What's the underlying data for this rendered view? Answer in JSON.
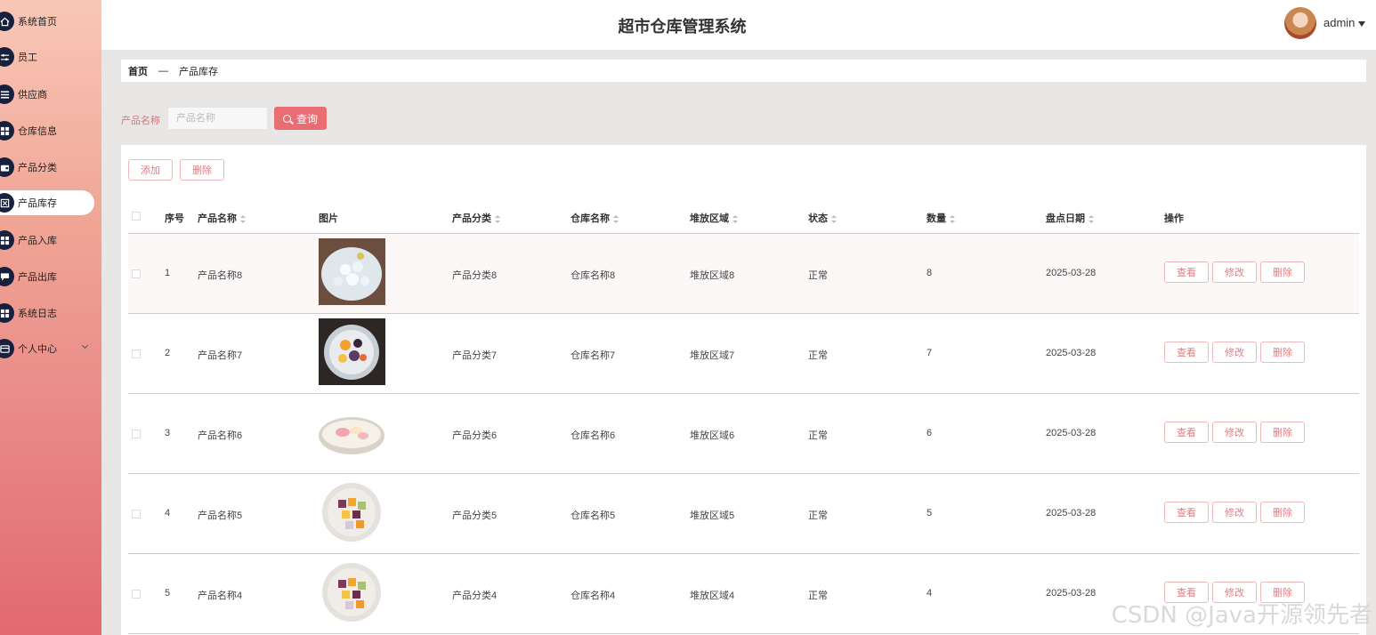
{
  "sidebar": {
    "items": [
      {
        "label": "系统首页",
        "icon": "home-icon"
      },
      {
        "label": "员工",
        "icon": "sliders-icon"
      },
      {
        "label": "供应商",
        "icon": "list-icon"
      },
      {
        "label": "仓库信息",
        "icon": "grid-icon"
      },
      {
        "label": "产品分类",
        "icon": "wallet-icon"
      },
      {
        "label": "产品库存",
        "icon": "box-icon",
        "active": true
      },
      {
        "label": "产品入库",
        "icon": "grid-icon"
      },
      {
        "label": "产品出库",
        "icon": "chat-icon"
      },
      {
        "label": "系统日志",
        "icon": "grid-icon"
      },
      {
        "label": "个人中心",
        "icon": "card-icon",
        "has_submenu": true
      }
    ]
  },
  "header": {
    "title": "超市仓库管理系统",
    "username": "admin"
  },
  "breadcrumb": {
    "home": "首页",
    "separator": "—",
    "current": "产品库存"
  },
  "search": {
    "label": "产品名称",
    "placeholder": "产品名称",
    "value": "",
    "button": "查询"
  },
  "toolbar": {
    "add": "添加",
    "delete": "删除"
  },
  "table": {
    "columns": [
      "序号",
      "产品名称",
      "图片",
      "产品分类",
      "仓库名称",
      "堆放区域",
      "状态",
      "数量",
      "盘点日期",
      "操作"
    ],
    "row_actions": {
      "view": "查看",
      "edit": "修改",
      "delete": "删除"
    },
    "rows": [
      {
        "index": "1",
        "name": "产品名称8",
        "image": "shaved-ice-photo",
        "category": "产品分类8",
        "warehouse": "仓库名称8",
        "area": "堆放区域8",
        "status": "正常",
        "quantity": "8",
        "date": "2025-03-28"
      },
      {
        "index": "2",
        "name": "产品名称7",
        "image": "dessert-bowl-photo",
        "category": "产品分类7",
        "warehouse": "仓库名称7",
        "area": "堆放区域7",
        "status": "正常",
        "quantity": "7",
        "date": "2025-03-28"
      },
      {
        "index": "3",
        "name": "产品名称6",
        "image": "rolls-plate-photo",
        "category": "产品分类6",
        "warehouse": "仓库名称6",
        "area": "堆放区域6",
        "status": "正常",
        "quantity": "6",
        "date": "2025-03-28"
      },
      {
        "index": "4",
        "name": "产品名称5",
        "image": "taro-balls-photo",
        "category": "产品分类5",
        "warehouse": "仓库名称5",
        "area": "堆放区域5",
        "status": "正常",
        "quantity": "5",
        "date": "2025-03-28"
      },
      {
        "index": "5",
        "name": "产品名称4",
        "image": "taro-balls-photo",
        "category": "产品分类4",
        "warehouse": "仓库名称4",
        "area": "堆放区域4",
        "status": "正常",
        "quantity": "4",
        "date": "2025-03-28"
      }
    ]
  },
  "watermark": "CSDN @Java开源领先者",
  "colors": {
    "accent": "#e86e74",
    "outline": "#f1b8b9",
    "sidebar_dark": "#17203d"
  }
}
